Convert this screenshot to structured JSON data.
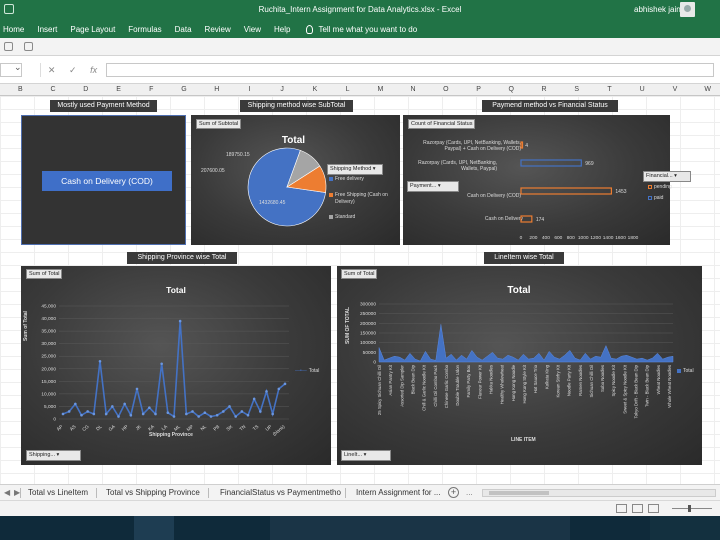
{
  "window": {
    "title": "Ruchita_Intern Assignment for Data Analytics.xlsx  -  Excel",
    "user": "abhishek jain"
  },
  "ribbon": {
    "tabs": [
      "Home",
      "Insert",
      "Page Layout",
      "Formulas",
      "Data",
      "Review",
      "View",
      "Help"
    ],
    "tell_me": "Tell me what you want to do"
  },
  "formula_bar": {
    "cancel_icon": "✕",
    "enter_icon": "✓",
    "fx_label": "fx",
    "value": ""
  },
  "columns": [
    "B",
    "C",
    "D",
    "E",
    "F",
    "G",
    "H",
    "I",
    "J",
    "K",
    "L",
    "M",
    "N",
    "O",
    "P",
    "Q",
    "R",
    "S",
    "T",
    "U",
    "V",
    "W"
  ],
  "charts": {
    "payment_method": {
      "header": "Mostly used Payment Method",
      "card_text": "Cash on Delivery (COD)"
    },
    "shipping_subtotal": {
      "header": "Shipping method wise SubTotal",
      "field_button": "Sum of Subtotal",
      "filter_button": "Shipping Method",
      "title": "Total"
    },
    "financial_status": {
      "header": "Paymend method vs Financial Status",
      "field_button": "Count of Financial Status",
      "row_filter": "Payment...",
      "col_filter": "Financial..."
    },
    "province": {
      "header": "Shipping Province wise Total",
      "field_button": "Sum of Total",
      "title": "Total",
      "filter_button": "Shipping..."
    },
    "lineitem": {
      "header": "LineItem wise Total",
      "field_button": "Sum of Total",
      "title": "Total",
      "filter_button": "LineIt..."
    }
  },
  "chart_data": [
    {
      "type": "pie",
      "title": "Total",
      "categories": [
        "Free delivery",
        "Free Shipping (Cash on Delivery)",
        "Standard"
      ],
      "values": [
        1432680.45,
        207600.05,
        189750.15
      ],
      "data_labels": [
        "1432680.45",
        "207600.05",
        "189750.15"
      ],
      "colors": [
        "#4472c4",
        "#ed7d31",
        "#a5a5a5"
      ],
      "legend": "right"
    },
    {
      "type": "bar",
      "orientation": "horizontal",
      "categories": [
        "Razorpay (Cards, UPI, NetBanking, Wallets, Paypal) + Cash on Delivery (COD)",
        "Razorpay (Cards, UPI, NetBanking, Wallets, Paypal)",
        "Cash on Delivery (COD)",
        "Cash on Delivery"
      ],
      "series": [
        {
          "name": "pending",
          "color": "#ed7d31",
          "values": [
            4,
            null,
            1453,
            174
          ]
        },
        {
          "name": "paid",
          "color": "#4472c4",
          "values": [
            null,
            969,
            null,
            null
          ]
        }
      ],
      "data_labels": [
        "4",
        "969",
        "1453",
        "174"
      ],
      "x_ticks": [
        "0",
        "200",
        "400",
        "600",
        "800",
        "1000",
        "1200",
        "1400",
        "1600",
        "1800"
      ],
      "xlim": [
        0,
        1800
      ],
      "legend": "right"
    },
    {
      "type": "line",
      "title": "Total",
      "xlabel": "Shipping Province",
      "ylabel": "Sum of Total",
      "y_ticks": [
        "0",
        "5000",
        "10000",
        "15000",
        "20000",
        "25000",
        "30000",
        "35000",
        "40000",
        "45000"
      ],
      "ylim": [
        0,
        45000
      ],
      "x_ticks": [
        "AP",
        "AS",
        "CG",
        "DL",
        "GA",
        "HP",
        "JK",
        "KA",
        "LA",
        "ML",
        "MP",
        "NL",
        "PB",
        "SK",
        "TN",
        "TS",
        "UP",
        "(blank)"
      ],
      "series": [
        {
          "name": "Total",
          "color": "#4472c4",
          "values": [
            2000,
            3000,
            6000,
            1500,
            3000,
            2000,
            23000,
            2000,
            5000,
            1000,
            6000,
            1500,
            12000,
            2000,
            4500,
            2000,
            22000,
            2500,
            1000,
            39000,
            2000,
            3000,
            1000,
            2500,
            1000,
            1500,
            3000,
            5000,
            1000,
            3000,
            1500,
            8000,
            3000,
            11000,
            2000,
            12000,
            14000
          ]
        }
      ],
      "legend": "right"
    },
    {
      "type": "area",
      "title": "Total",
      "xlabel": "LINE ITEM",
      "ylabel": "SUM OF TOTAL",
      "y_ticks": [
        "0",
        "50000",
        "100000",
        "150000",
        "200000",
        "250000",
        "300000"
      ],
      "ylim": [
        0,
        300000
      ],
      "x_ticks": [
        "25 Spicy Sichuan Chilli Oil",
        "Asian Pantry Kit",
        "Assorted Dip Sampler",
        "Black Bean Dip",
        "Chill & Garlic Noodle Kit",
        "Chilli Oil Combo Pack",
        "Chinese Garlic Combo",
        "Double Trouble Udon",
        "Family Party Box",
        "Flavour Power Kit",
        "Hakka Noodles",
        "Healthy Wholewheat",
        "Hong Kong Noodle",
        "Hong Kong Style Kit",
        "Hot Sauce Trio",
        "Kolkata King",
        "Korean Stirfry Kit",
        "Noodle Party Kit",
        "Ramen Noodles",
        "Sichuan Chilli Oil",
        "Soba Noodles",
        "Spicy Noodle Kit",
        "Sweet & Spicy Noodle Kit",
        "Tokyo Drift - Black Bean Dip",
        "Twin - Black Bean Dip",
        "Wheat Noodles",
        "Whole Wheat Noodles"
      ],
      "series": [
        {
          "name": "Total",
          "color": "#4472c4",
          "values": [
            75000,
            10000,
            20000,
            30000,
            25000,
            10000,
            45000,
            15000,
            5000,
            55000,
            15000,
            8000,
            195000,
            20000,
            40000,
            10000,
            35000,
            15000,
            60000,
            25000,
            10000,
            30000,
            50000,
            20000,
            15000,
            35000,
            25000,
            10000,
            40000,
            15000,
            20000,
            45000,
            10000,
            55000,
            25000,
            15000,
            35000,
            60000,
            20000,
            10000,
            45000,
            15000,
            30000,
            25000,
            85000,
            20000,
            15000,
            30000,
            35000,
            25000,
            15000,
            20000,
            10000,
            20000,
            45000,
            15000,
            25000,
            30000
          ]
        }
      ],
      "legend": "right"
    }
  ],
  "sheet_tabs": [
    "Total vs LineItem",
    "Total vs Shipping Province",
    "FinancialStatus vs Paymentmetho",
    "Intern Assignment for ..."
  ],
  "icons": {
    "add_sheet": "+",
    "tab_prev": "◀",
    "tab_next": "▶",
    "overflow_left": "...",
    "overflow_right": "...",
    "line_legend_marker": "—•—"
  }
}
